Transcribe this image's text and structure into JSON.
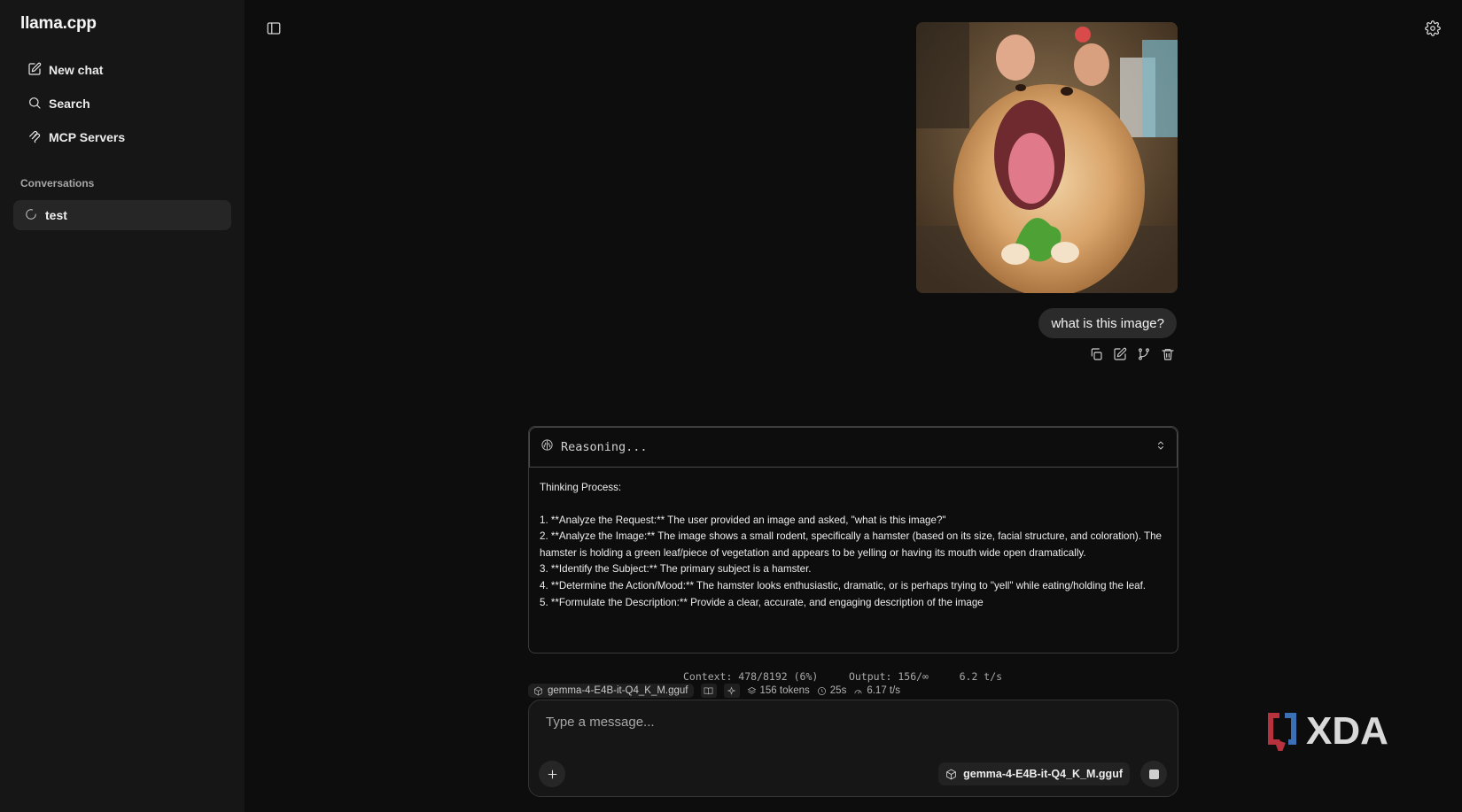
{
  "app": {
    "title": "llama.cpp"
  },
  "sidebar": {
    "nav": [
      {
        "label": "New chat",
        "icon": "edit-icon"
      },
      {
        "label": "Search",
        "icon": "search-icon"
      },
      {
        "label": "MCP Servers",
        "icon": "mcp-icon"
      }
    ],
    "section_label": "Conversations",
    "conversations": [
      {
        "label": "test",
        "status": "loading"
      }
    ]
  },
  "chat": {
    "user_message": "what is this image?",
    "reasoning": {
      "title": "Reasoning...",
      "heading": "Thinking Process:",
      "lines": [
        "1.  **Analyze the Request:** The user provided an image and asked, \"what is this image?\"",
        "2.  **Analyze the Image:** The image shows a small rodent, specifically a hamster (based on its size, facial structure, and coloration). The hamster is holding a green leaf/piece of vegetation and appears to be yelling or having its mouth wide open dramatically.",
        "3.  **Identify the Subject:** The primary subject is a hamster.",
        "4.  **Determine the Action/Mood:** The hamster looks enthusiastic, dramatic, or is perhaps trying to \"yell\" while eating/holding the leaf.",
        "5.  **Formulate the Description:** Provide a clear, accurate, and engaging description of the image"
      ]
    },
    "stats": {
      "context": "Context: 478/8192 (6%)",
      "output": "Output: 156/∞",
      "speed": "6.2 t/s",
      "model": "gemma-4-E4B-it-Q4_K_M.gguf",
      "tokens": "156 tokens",
      "time": "25s",
      "rate": "6.17 t/s"
    }
  },
  "composer": {
    "placeholder": "Type a message...",
    "model": "gemma-4-E4B-it-Q4_K_M.gguf"
  },
  "watermark": {
    "text": "XDA"
  }
}
